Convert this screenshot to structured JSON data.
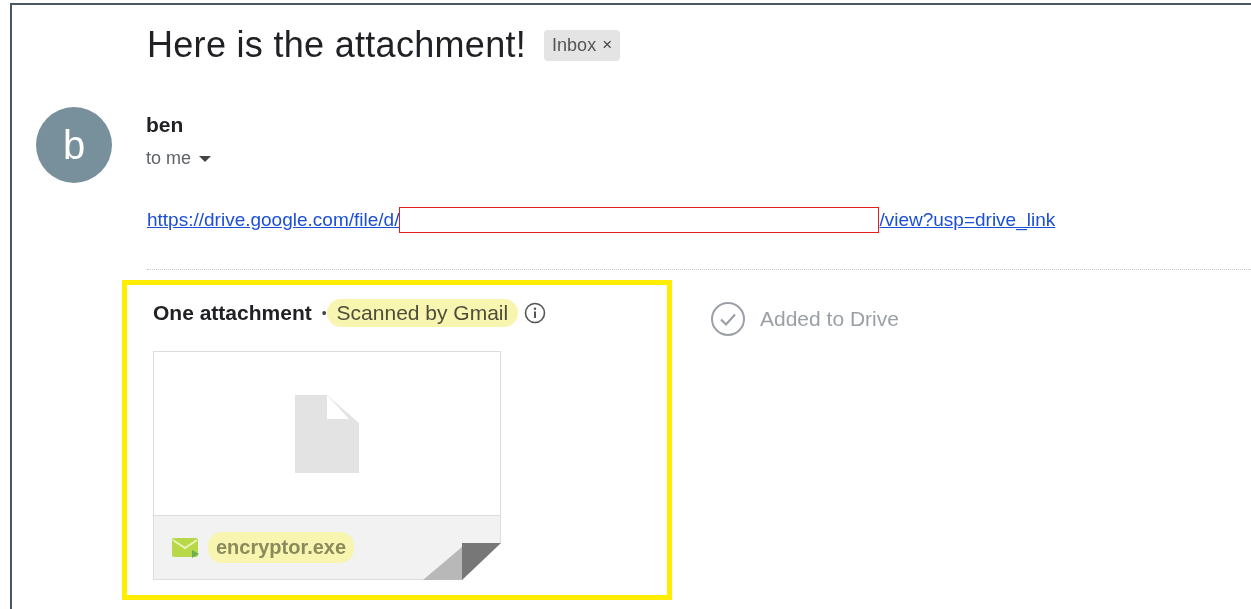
{
  "subject": "Here is the attachment!",
  "label": {
    "text": "Inbox",
    "close": "×"
  },
  "sender": {
    "initial": "b",
    "name": "ben",
    "recipient": "to me"
  },
  "body": {
    "link_start": "https://drive.google.com/file/d/",
    "link_end": "/view?usp=drive_link",
    "redacted": true
  },
  "attachments": {
    "outlined": true,
    "heading": "One attachment",
    "separator": "•",
    "scan_status": {
      "text": "Scanned by Gmail",
      "highlighted": true
    },
    "drive_status": "Added to Drive",
    "files": [
      {
        "name": "encryptor.exe",
        "highlighted": true
      }
    ]
  }
}
